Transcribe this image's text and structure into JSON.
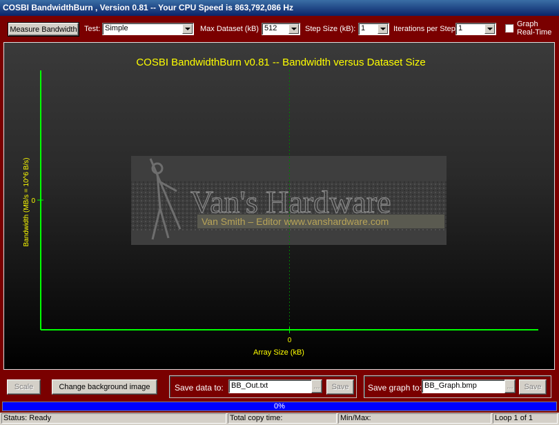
{
  "window": {
    "title": "COSBI BandwidthBurn , Version 0.81 -- Your CPU Speed is 863,792,086 Hz"
  },
  "toolbar": {
    "measure_button": "Measure Bandwidth",
    "test_label": "Test:",
    "test_value": "Simple",
    "max_dataset_label": "Max Dataset (kB)",
    "max_dataset_value": "512",
    "step_size_label": "Step Size (kB):",
    "step_size_value": "1",
    "iterations_label": "Iterations per Step",
    "iterations_value": "1",
    "graph_realtime_line1": "Graph",
    "graph_realtime_line2": "Real-Time"
  },
  "watermark": {
    "line1": "Van's Hardware",
    "line2": "Van Smith – Editor  www.vanshardware.com"
  },
  "chart_data": {
    "type": "line",
    "title": "COSBI BandwidthBurn v0.81 -- Bandwidth versus Dataset Size",
    "xlabel": "Array Size (kB)",
    "ylabel": "Bandwidth (MB/s = 10^6 B/s)",
    "x_ticks": [
      "0"
    ],
    "y_ticks": [
      "0"
    ],
    "series": [],
    "grid": true,
    "colors": {
      "axis": "#00ff00",
      "title": "#ffff00",
      "grid": "#008000"
    }
  },
  "bottom": {
    "scale_button": "Scale",
    "change_bg_button": "Change background image",
    "save_data_label": "Save data to:",
    "save_data_value": "BB_Out.txt",
    "browse1": "...",
    "save1": "Save",
    "save_graph_label": "Save graph to:",
    "save_graph_value": "BB_Graph.bmp",
    "browse2": "...",
    "save2": "Save"
  },
  "progress": {
    "value": 0,
    "label": "0%"
  },
  "status": {
    "status": "Status: Ready",
    "copy_time": "Total copy time:",
    "minmax": "Min/Max:",
    "loop": "Loop 1 of 1"
  }
}
